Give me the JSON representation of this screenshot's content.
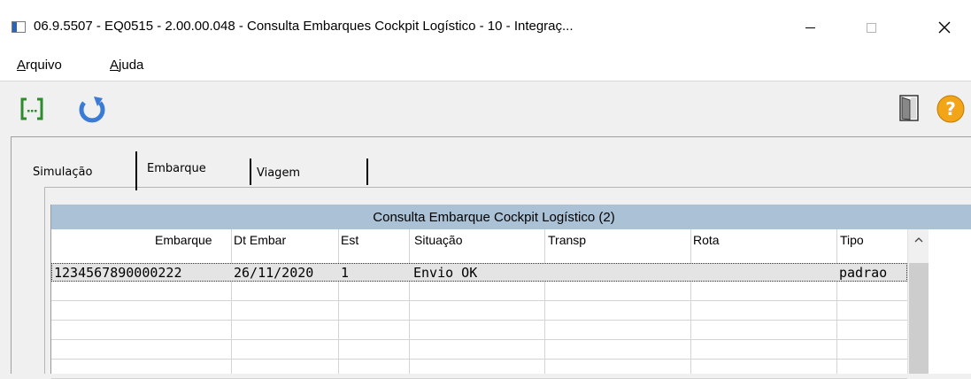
{
  "window": {
    "title": "06.9.5507 - EQ0515 - 2.00.00.048 - Consulta Embarques Cockpit Logístico - 10 - Integraç...",
    "minimize_glyph": "—",
    "maximize_glyph": "☐",
    "close_glyph": "✕"
  },
  "menu": {
    "arquivo": {
      "accel": "A",
      "rest": "rquivo"
    },
    "ajuda": {
      "accel": "A",
      "rest": "juda"
    }
  },
  "toolbar": {
    "icons": [
      "confirm-icon",
      "refresh-icon",
      "exit-door-icon",
      "help-icon"
    ],
    "colors": {
      "confirm": "#2e8b2e",
      "refresh": "#3a7bd5",
      "help": "#f2a516"
    }
  },
  "tabs": {
    "simulacao": "Simulação",
    "embarque": "Embarque",
    "viagem": "Viagem",
    "active": "Embarque"
  },
  "grid": {
    "title": "Consulta Embarque Cockpit Logístico (2)",
    "columns": [
      "Embarque",
      "Dt Embar",
      "Est",
      "Situação",
      "Transp",
      "Rota",
      "Tipo"
    ],
    "rows": [
      {
        "embarque": "1234567890000222",
        "dt_embar": "26/11/2020",
        "est": "1",
        "situacao": "Envio OK",
        "transp": "",
        "rota": "",
        "tipo": "padrao"
      }
    ],
    "header_color": "#aac1d6"
  }
}
